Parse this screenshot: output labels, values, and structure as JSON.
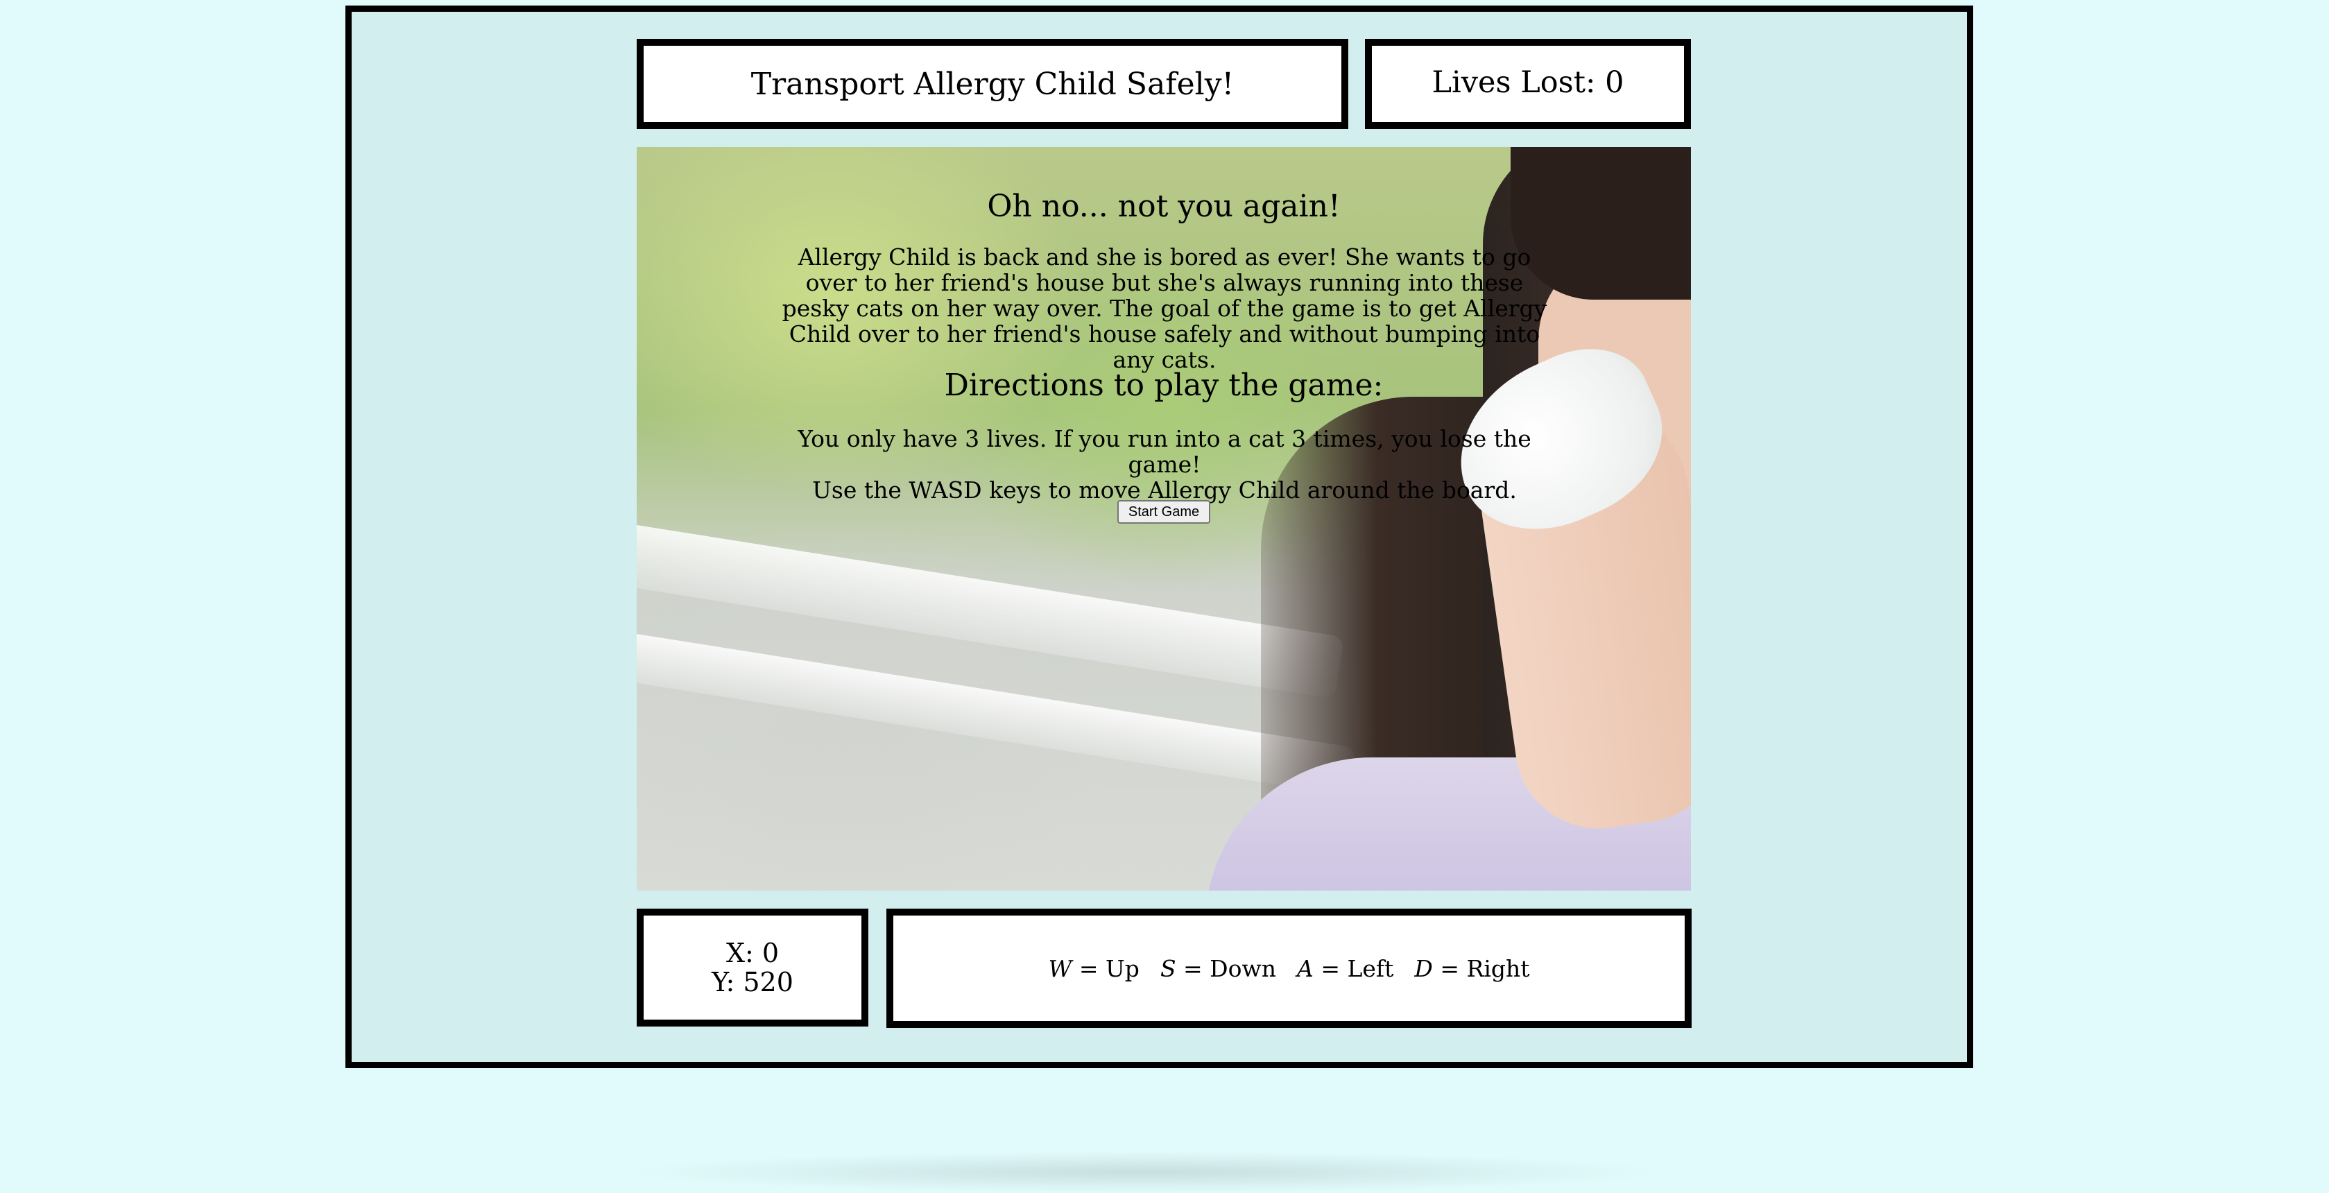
{
  "header": {
    "title": "Transport Allergy Child Safely!",
    "lives_label": "Lives Lost: 0"
  },
  "intro_screen": {
    "heading": "Oh no... not you again!",
    "description": "Allergy Child is back and she is bored as ever! She wants to go over to her friend's house but she's always running into these pesky cats on her way over. The goal of the game is to get Allergy Child over to her friend's house safely and without bumping into any cats.",
    "directions_heading": "Directions to play the game:",
    "directions_line1": "You only have 3 lives. If you run into a cat 3 times, you lose the game!",
    "directions_line2": "Use the WASD keys to move Allergy Child around the board.",
    "start_button": "Start Game",
    "background_image": "girl-sneezing-into-tissue"
  },
  "coordinates": {
    "x_label": "X: 0",
    "y_label": "Y: 520"
  },
  "controls": {
    "up_key": "W",
    "up_label": " = Up",
    "down_key": "S",
    "down_label": " = Down",
    "left_key": "A",
    "left_label": " = Left",
    "right_key": "D",
    "right_label": " = Right"
  },
  "colors": {
    "page_background": "#e1fbfc",
    "frame_background": "#d3eeef",
    "border": "#000000",
    "panel": "#ffffff"
  }
}
